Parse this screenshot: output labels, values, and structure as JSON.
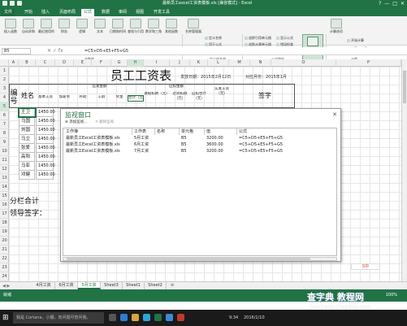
{
  "window": {
    "title": "最新员工excel工资表模板.xls [兼容模式] - Excel",
    "controls": [
      "?",
      "—",
      "□",
      "✕"
    ]
  },
  "ribbon": {
    "file_tab": "文件",
    "tabs": [
      "开始",
      "插入",
      "页面布局",
      "公式",
      "数据",
      "审阅",
      "视图",
      "开发工具"
    ],
    "active_tab": "公式",
    "buttons": [
      {
        "icon": "fx-icon",
        "label": "插入函数"
      },
      {
        "icon": "sum-icon",
        "label": "自动求和"
      },
      {
        "icon": "recent-icon",
        "label": "最近使用的函数"
      },
      {
        "icon": "finance-icon",
        "label": "财务"
      },
      {
        "icon": "logic-icon",
        "label": "逻辑"
      },
      {
        "icon": "text-icon",
        "label": "文本"
      },
      {
        "icon": "datetime-icon",
        "label": "日期和时间"
      },
      {
        "icon": "lookup-icon",
        "label": "查找与引用"
      },
      {
        "icon": "math-icon",
        "label": "数学和三角函数"
      },
      {
        "icon": "more-icon",
        "label": "其他函数"
      },
      {
        "icon": "name-manager-icon",
        "label": "名称管理器"
      }
    ],
    "small_buttons": [
      "定义名称",
      "用于公式",
      "根据所选内容创建",
      "追踪引用单元格",
      "追踪从属单元格",
      "移去箭头",
      "显示公式",
      "错误检查",
      "公式求值"
    ],
    "watch_button": "监视窗口",
    "calc_options": "计算选项",
    "calc_now": "开始计算",
    "calc_sheet": "计算工作表",
    "groups": [
      "函数库",
      "定义的名称",
      "公式审核",
      "计算"
    ]
  },
  "formula_bar": {
    "name_box": "B5",
    "icons": "✕  ✓  fx",
    "formula": "=C5+D5+E5+F5+G5"
  },
  "columns": [
    "A",
    "B",
    "C",
    "D",
    "E",
    "F",
    "G",
    "H",
    "I",
    "J",
    "K",
    "L",
    "M",
    "N",
    "O",
    "P"
  ],
  "selected_column": "H",
  "rows": [
    "1",
    "2",
    "3",
    "4",
    "5",
    "6",
    "7",
    "8",
    "9",
    "10",
    "11",
    "12",
    "13",
    "14",
    "15",
    "16",
    "17",
    "18",
    "19",
    "20",
    "21",
    "22",
    "23",
    "24"
  ],
  "selected_row": "5",
  "sheet": {
    "title": "员工工资表",
    "issue_date": "发放日期：2015年2月12日",
    "salary_month_label": "对应月份：2015年1月",
    "header_no": "编号",
    "header_name": "姓名",
    "header_payable": "应发金额",
    "header_deduct": "应扣金额",
    "header_actual": "实发工资（元）",
    "header_sign": "签字",
    "sub_headers": [
      "基本工资",
      "加薪奖",
      "补助",
      "工龄",
      "奖金",
      "合计（元）",
      "请假扣款（元）",
      "迟到扣款（元）",
      "应扣合计（元）"
    ],
    "names": [
      "王卫明",
      "马国鑫",
      "刘国成",
      "马立成",
      "张爱英",
      "高阳",
      "马亚丽",
      "邓健"
    ],
    "base_pay": [
      "1450.00",
      "1450.00",
      "1450.00",
      "1450.00",
      "1450.00",
      "1450.00",
      "1450.00",
      "1450.00"
    ],
    "footer_total": "分栏合计",
    "footer_sign": "领导签字："
  },
  "watch_window": {
    "title": "监视窗口",
    "add_label": "添加监视...",
    "delete_label": "删除监视",
    "columns": [
      "工作簿",
      "工作表",
      "名称",
      "单元格",
      "值",
      "公式"
    ],
    "rows": [
      {
        "book": "最新员工Excel工资表模板.xls",
        "sheet": "5月工资",
        "name": "",
        "cell": "B5",
        "value": "3200.00",
        "formula": "=C5+D5+E5+F5+G5"
      },
      {
        "book": "最新员工Excel工资表模板.xls",
        "sheet": "6月工资",
        "name": "",
        "cell": "B5",
        "value": "3600.00",
        "formula": "=C5+D5+E5+F5+G5"
      },
      {
        "book": "最新员工Excel工资表模板.xls",
        "sheet": "7月工资",
        "name": "",
        "cell": "B5",
        "value": "3200.00",
        "formula": "=C5+D5+E5+F5+G5"
      }
    ]
  },
  "sheet_tabs": {
    "nav": "◀ ▶",
    "tabs": [
      "4月工资",
      "6月工资",
      "5月工资",
      "Sheet3",
      "Sheet1",
      "Sheet2"
    ],
    "active": "5月工资",
    "add": "⊕"
  },
  "status": {
    "ready": "就绪",
    "zoom": "100%"
  },
  "taskbar": {
    "start": "⊞",
    "search": "我是 Cortana，小娜。有问题尽管问我。",
    "time": "9:34",
    "date": "2016/1/10"
  },
  "ime": "S中",
  "watermark": {
    "main": "查字典 教程网",
    "sub": "jiaocheng.chazidian.com"
  },
  "colors": {
    "excel_green": "#217346",
    "taskbar": "#1a1a1a"
  }
}
